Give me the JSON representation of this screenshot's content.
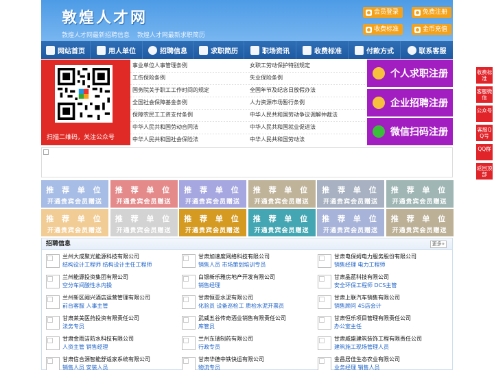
{
  "header": {
    "title": "敦煌人才网",
    "subtitles": [
      "敦煌人才网最新招聘信息",
      "敦煌人才网最新求职简历"
    ],
    "buttons": {
      "login": "会员登录",
      "register": "免费注册",
      "fees": "收费标准",
      "recharge": "金币充值"
    }
  },
  "nav": {
    "items": [
      "网站首页",
      "用人单位",
      "招聘信息",
      "求职简历",
      "职场资讯",
      "收费标准",
      "付款方式",
      "联系客服"
    ]
  },
  "qr": {
    "caption": "扫描二维码，关注公众号"
  },
  "links": {
    "left": [
      "事业单位人事管理条例",
      "工伤保险条例",
      "国务院关于职工工作时间的规定",
      "全国社会保障基金条例",
      "保障农民工工资支付条例",
      "中华人民共和国劳动合同法",
      "中华人民共和国社会保险法"
    ],
    "right": [
      "女职工劳动保护特别规定",
      "失业保险条例",
      "全国年节及纪念日放假办法",
      "人力资源市场暂行条例",
      "中华人民共和国劳动争议调解仲裁法",
      "中华人民共和国就业促进法",
      "中华人民共和国劳动法"
    ]
  },
  "register": {
    "personal": "个人求职注册",
    "company": "企业招聘注册",
    "wechat": "微信扫码注册"
  },
  "recommend": {
    "title": "推 荐 单 位",
    "subtitle": "开通贵宾会员赠送",
    "colors": [
      "#a7bde6",
      "#e58a8a",
      "#a6a7e0",
      "#bfb39a",
      "#a7b1c1",
      "#9fb6b5",
      "#f2cc95",
      "#d3d3d3",
      "#d59a22",
      "#43a6b2",
      "#a7b3d9",
      "#bcb097"
    ]
  },
  "jobs": {
    "title": "招聘信息",
    "more": "更多»",
    "columns": [
      [
        {
          "company": "兰州大成聚光能源科技有限公司",
          "positions": "结构设计工程师  结构设计主任工程师"
        },
        {
          "company": "兰州能源投资集团有限公司",
          "positions": "空分车间酸性水内操"
        },
        {
          "company": "兰州新区阙兴酒店运营管理有限公司",
          "positions": "前台客服  人事主管"
        },
        {
          "company": "甘肃莱美医药投资有限责任公司",
          "positions": "法务专员"
        },
        {
          "company": "甘肃金雨洁防水科技有限公司",
          "positions": "人资主管  销售经理"
        },
        {
          "company": "甘肃信合源智能舒适家系统有限公司",
          "positions": "销售人员  安装人员"
        }
      ],
      [
        {
          "company": "甘肃加速度网络科技有限公司",
          "positions": "销售人员  市场策划培训专员"
        },
        {
          "company": "白银新乐雅房地产开发有限公司",
          "positions": "销售经理"
        },
        {
          "company": "甘肃恒亚水泥有限公司",
          "positions": "化验员  设备巡检工  质检水泥开票员"
        },
        {
          "company": "武威五谷传奇酒业销售有限责任公司",
          "positions": "库管员"
        },
        {
          "company": "兰州东瑞制药有限公司",
          "positions": "行政专员"
        },
        {
          "company": "甘肃华德中铁快运有限公司",
          "positions": "物流专员"
        }
      ],
      [
        {
          "company": "甘肃电保姆电力服务股份有限公司",
          "positions": "销售经理  电力工程师"
        },
        {
          "company": "甘肃晶蓝科技有限公司",
          "positions": "安全环保工程师  DCS主管"
        },
        {
          "company": "甘肃上联汽车销售有限公司",
          "positions": "销售顾问  4S店会计"
        },
        {
          "company": "甘肃恒乐项目管理有限责任公司",
          "positions": "办公室主任"
        },
        {
          "company": "甘肃威盛建筑装饰工程有限责任公司",
          "positions": "建筑施工现场管理人员"
        },
        {
          "company": "金昌居佳生态农业有限公司",
          "positions": "业务经理  销售人员"
        }
      ]
    ]
  },
  "side": {
    "items": [
      "收费标准",
      "客服微信",
      "公众号",
      "客服QQ号",
      "QQ群",
      "返回顶部"
    ]
  }
}
